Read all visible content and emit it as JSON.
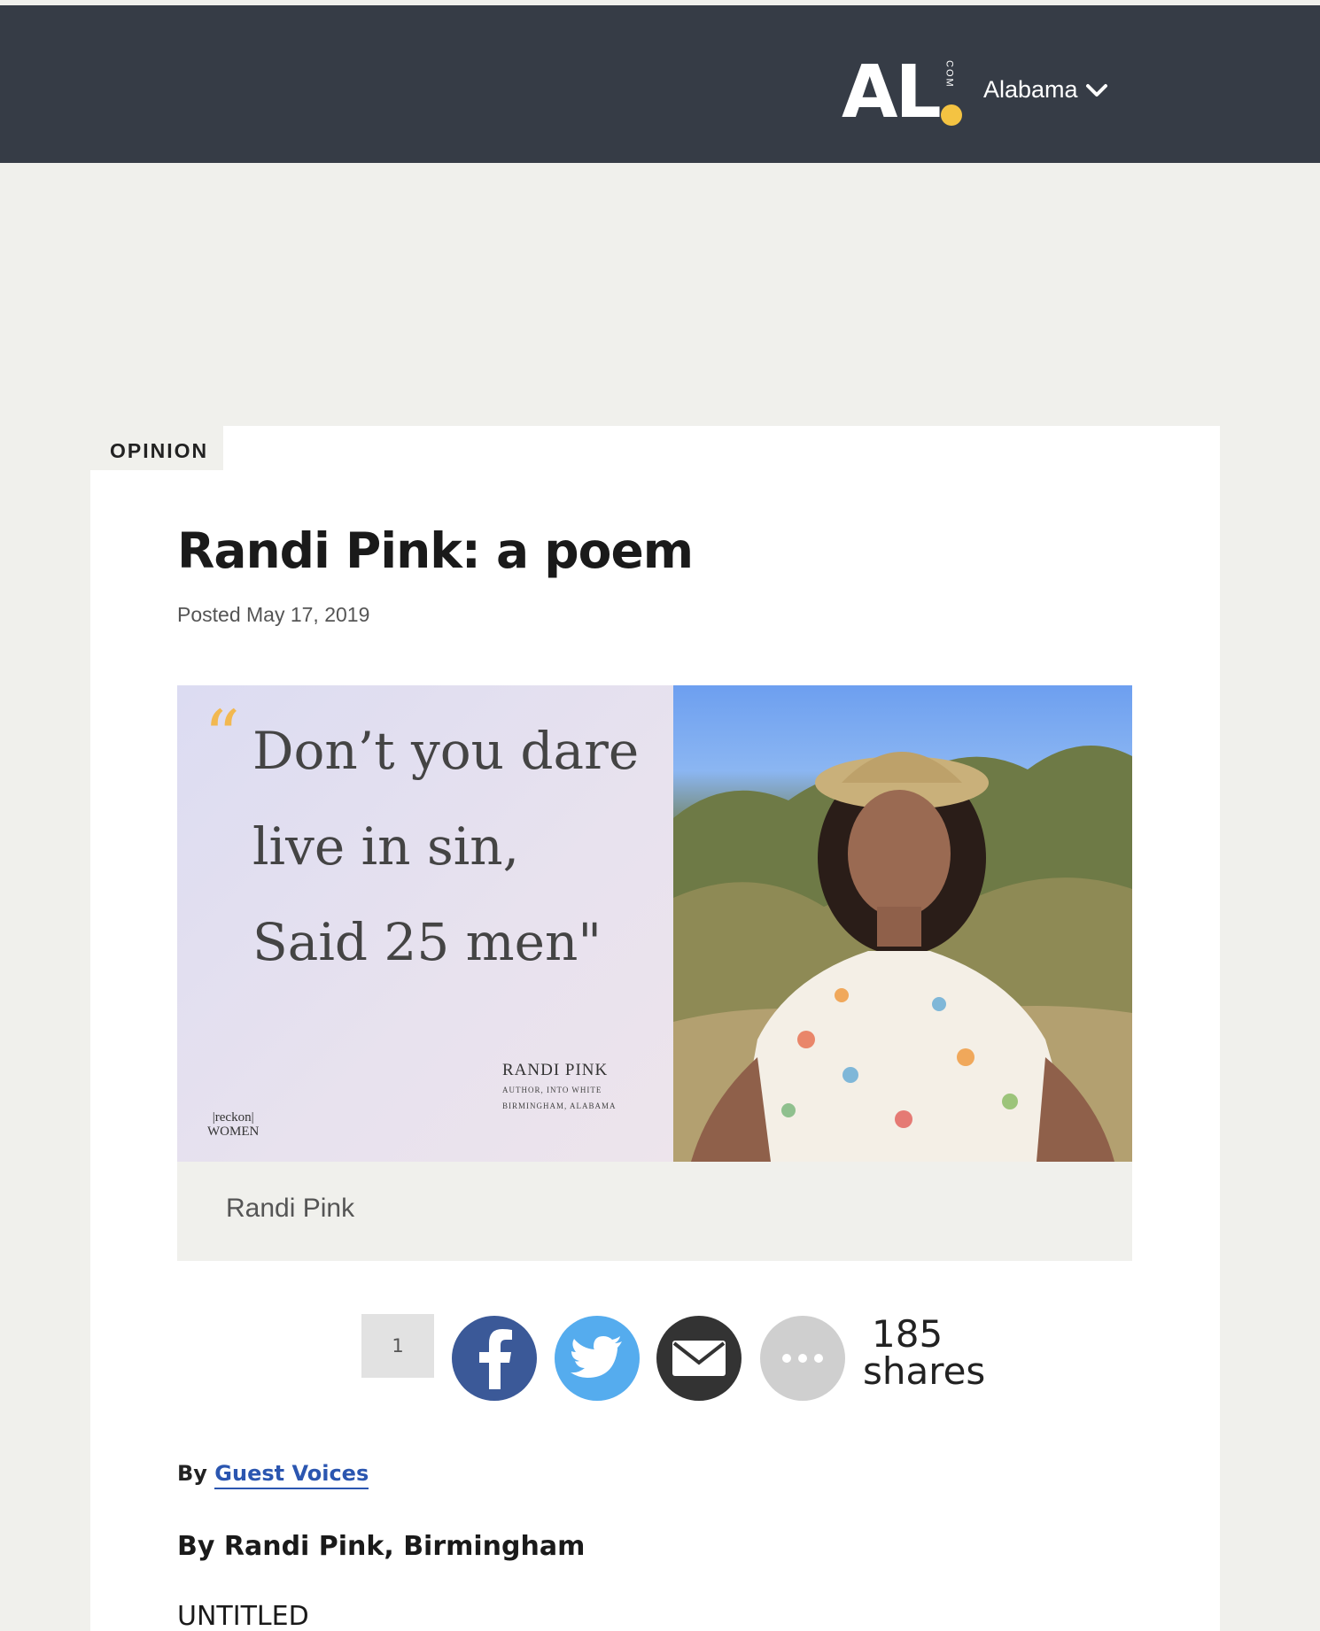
{
  "header": {
    "logo_text": "AL",
    "logo_suffix": "COM",
    "region_label": "Alabama",
    "colors": {
      "bar": "#363c46",
      "logo_dot": "#f4c342"
    }
  },
  "article": {
    "section_tag": "OPINION",
    "title": "Randi Pink: a poem",
    "posted": "Posted May 17, 2019",
    "image": {
      "quote_lines": [
        "Don’t you dare",
        "live in sin,",
        "Said 25 men\""
      ],
      "author_name": "RANDI PINK",
      "author_role": "AUTHOR, INTO WHITE",
      "author_location": "BIRMINGHAM, ALABAMA",
      "brand_line1": "|reckon|",
      "brand_line2": "WOMEN",
      "caption": "Randi Pink"
    },
    "share": {
      "count_box": "1",
      "shares_count": "185",
      "shares_label": "shares",
      "icons": [
        "facebook-icon",
        "twitter-icon",
        "email-icon",
        "more-icon"
      ]
    },
    "byline_prefix": "By",
    "byline_author": "Guest Voices",
    "author_line": "By Randi Pink, Birmingham",
    "first_heading": "UNTITLED"
  }
}
